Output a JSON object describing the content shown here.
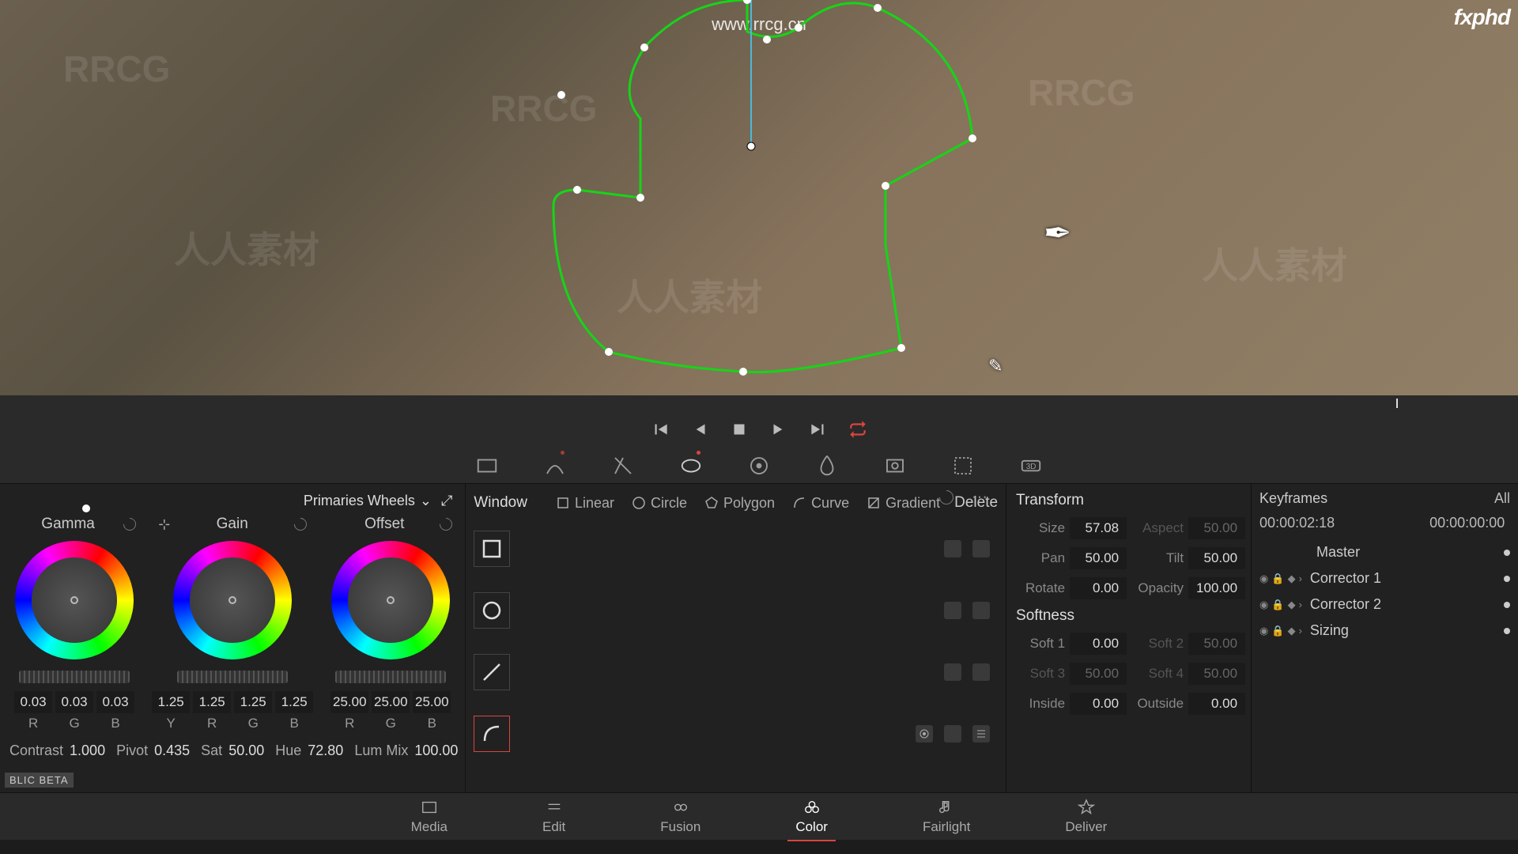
{
  "viewer": {
    "url_overlay": "www.rrcg.cn",
    "brand": "fxphd",
    "watermarks": [
      "RRCG",
      "人人素材"
    ]
  },
  "primaries": {
    "selector": "Primaries Wheels",
    "wheels": [
      {
        "name": "Gamma",
        "values": [
          "0.03",
          "0.03",
          "0.03"
        ],
        "labels": [
          "R",
          "G",
          "B"
        ]
      },
      {
        "name": "Gain",
        "values": [
          "1.25",
          "1.25",
          "1.25",
          "1.25"
        ],
        "labels": [
          "Y",
          "R",
          "G",
          "B"
        ]
      },
      {
        "name": "Offset",
        "values": [
          "25.00",
          "25.00",
          "25.00"
        ],
        "labels": [
          "R",
          "G",
          "B"
        ]
      }
    ],
    "bottom": [
      {
        "label": "Contrast",
        "value": "1.000"
      },
      {
        "label": "Pivot",
        "value": "0.435"
      },
      {
        "label": "Sat",
        "value": "50.00"
      },
      {
        "label": "Hue",
        "value": "72.80"
      },
      {
        "label": "Lum Mix",
        "value": "100.00"
      }
    ],
    "beta_tag": "BLIC BETA"
  },
  "window": {
    "title": "Window",
    "shapes": [
      "Linear",
      "Circle",
      "Polygon",
      "Curve",
      "Gradient"
    ],
    "delete": "Delete"
  },
  "transform": {
    "title": "Transform",
    "rows": [
      [
        {
          "label": "Size",
          "value": "57.08"
        },
        {
          "label": "Aspect",
          "value": "50.00",
          "disabled": true
        }
      ],
      [
        {
          "label": "Pan",
          "value": "50.00"
        },
        {
          "label": "Tilt",
          "value": "50.00"
        }
      ],
      [
        {
          "label": "Rotate",
          "value": "0.00"
        },
        {
          "label": "Opacity",
          "value": "100.00"
        }
      ]
    ],
    "softness_title": "Softness",
    "softness_rows": [
      [
        {
          "label": "Soft 1",
          "value": "0.00"
        },
        {
          "label": "Soft 2",
          "value": "50.00",
          "disabled": true
        }
      ],
      [
        {
          "label": "Soft 3",
          "value": "50.00",
          "disabled": true
        },
        {
          "label": "Soft 4",
          "value": "50.00",
          "disabled": true
        }
      ],
      [
        {
          "label": "Inside",
          "value": "0.00"
        },
        {
          "label": "Outside",
          "value": "0.00"
        }
      ]
    ]
  },
  "keyframes": {
    "title": "Keyframes",
    "all": "All",
    "tc_current": "00:00:02:18",
    "tc_end": "00:00:00:00",
    "master": "Master",
    "rows": [
      "Corrector 1",
      "Corrector 2",
      "Sizing"
    ]
  },
  "pages": [
    "Media",
    "Edit",
    "Fusion",
    "Color",
    "Fairlight",
    "Deliver"
  ]
}
